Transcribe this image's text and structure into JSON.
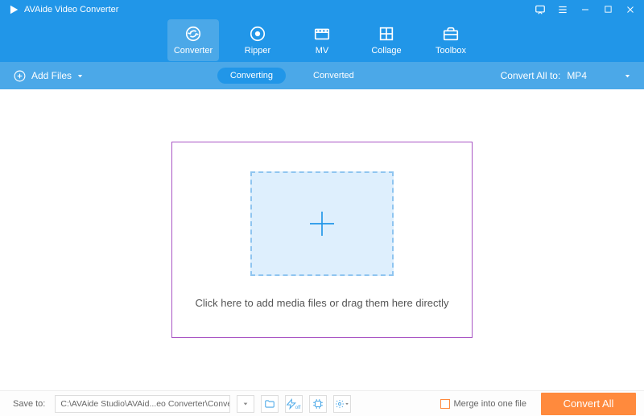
{
  "app": {
    "title": "AVAide Video Converter"
  },
  "nav": {
    "items": [
      {
        "label": "Converter",
        "active": true
      },
      {
        "label": "Ripper",
        "active": false
      },
      {
        "label": "MV",
        "active": false
      },
      {
        "label": "Collage",
        "active": false
      },
      {
        "label": "Toolbox",
        "active": false
      }
    ]
  },
  "subbar": {
    "add_files": "Add Files",
    "tab_converting": "Converting",
    "tab_converted": "Converted",
    "convert_all_to": "Convert All to:",
    "format": "MP4"
  },
  "main": {
    "drop_text": "Click here to add media files or drag them here directly"
  },
  "footer": {
    "save_to_label": "Save to:",
    "save_path": "C:\\AVAide Studio\\AVAid...eo Converter\\Converted",
    "merge_label": "Merge into one file",
    "convert_button": "Convert All"
  },
  "colors": {
    "primary": "#2196e8",
    "accent": "#ff8a3d",
    "outline": "#a855c4"
  }
}
